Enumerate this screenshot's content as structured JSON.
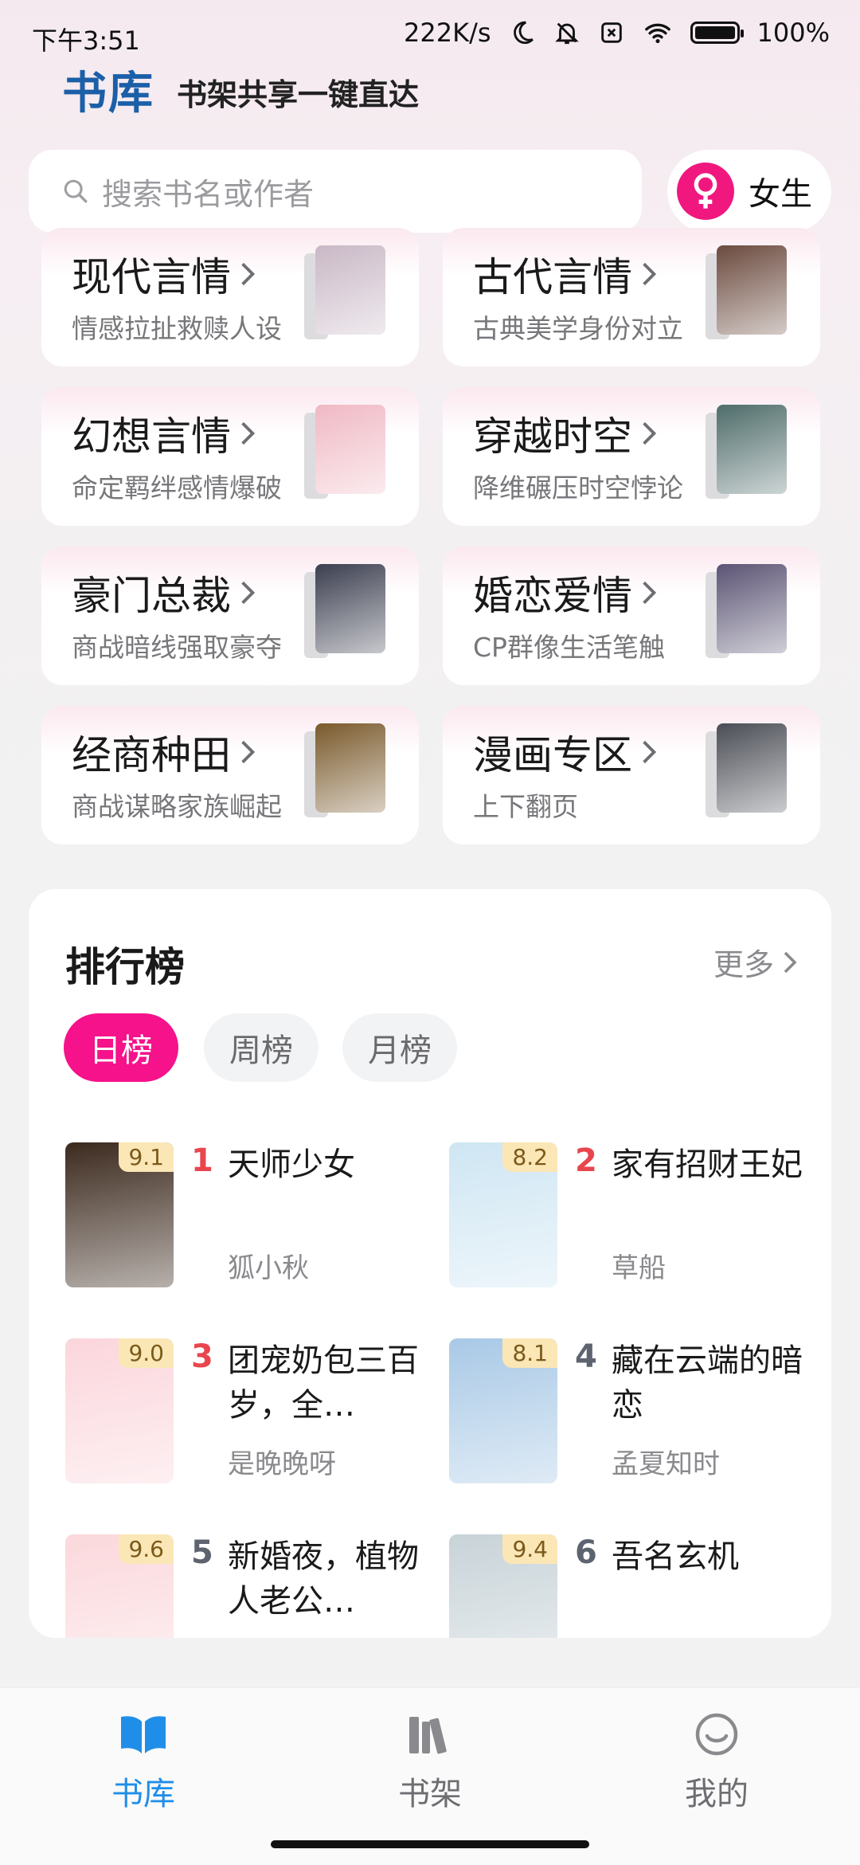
{
  "status_bar": {
    "time": "下午3:51",
    "speed": "222K/s",
    "battery": "100%"
  },
  "header": {
    "brand": "书库",
    "slogan": "书架共享一键直达"
  },
  "search": {
    "placeholder": "搜索书名或作者"
  },
  "gender": {
    "label": "女生"
  },
  "categories": [
    {
      "title": "现代言情",
      "subtitle": "情感拉扯救赎人设",
      "cover_color": "#c9b8c6"
    },
    {
      "title": "古代言情",
      "subtitle": "古典美学身份对立",
      "cover_color": "#6b4a3e"
    },
    {
      "title": "幻想言情",
      "subtitle": "命定羁绊感情爆破",
      "cover_color": "#f0b9c4"
    },
    {
      "title": "穿越时空",
      "subtitle": "降维碾压时空悖论",
      "cover_color": "#4e6c6a"
    },
    {
      "title": "豪门总裁",
      "subtitle": "商战暗线强取豪夺",
      "cover_color": "#3b3e4f"
    },
    {
      "title": "婚恋爱情",
      "subtitle": "CP群像生活笔触",
      "cover_color": "#5b5474"
    },
    {
      "title": "经商种田",
      "subtitle": "商战谋略家族崛起",
      "cover_color": "#7a5a2c"
    },
    {
      "title": "漫画专区",
      "subtitle": "上下翻页",
      "cover_color": "#4a4d55"
    }
  ],
  "ranking": {
    "title": "排行榜",
    "more": "更多",
    "tabs": [
      "日榜",
      "周榜",
      "月榜"
    ],
    "books": [
      {
        "rank": "1",
        "name": "天师少女",
        "author": "狐小秋",
        "score": "9.1",
        "cover_color": "#3c2a1e"
      },
      {
        "rank": "2",
        "name": "家有招财王妃",
        "author": "草船",
        "score": "8.2",
        "cover_color": "#cfe6f3"
      },
      {
        "rank": "3",
        "name": "团宠奶包三百岁，全…",
        "author": "是晚晚呀",
        "score": "9.0",
        "cover_color": "#fbd6dc"
      },
      {
        "rank": "4",
        "name": "藏在云端的暗恋",
        "author": "孟夏知时",
        "score": "8.1",
        "cover_color": "#a9c9e6"
      },
      {
        "rank": "5",
        "name": "新婚夜，植物人老公…",
        "author": "",
        "score": "9.6",
        "cover_color": "#fbd8dc"
      },
      {
        "rank": "6",
        "name": "吾名玄机",
        "author": "",
        "score": "9.4",
        "cover_color": "#c8d3d8"
      }
    ]
  },
  "nav": {
    "items": [
      {
        "label": "书库",
        "active": true
      },
      {
        "label": "书架",
        "active": false
      },
      {
        "label": "我的",
        "active": false
      }
    ]
  },
  "colors": {
    "accent_pink": "#f5128a",
    "brand_blue": "#1b5fa8",
    "nav_active": "#1f8ee8",
    "rank_hot": "#e8464d"
  }
}
